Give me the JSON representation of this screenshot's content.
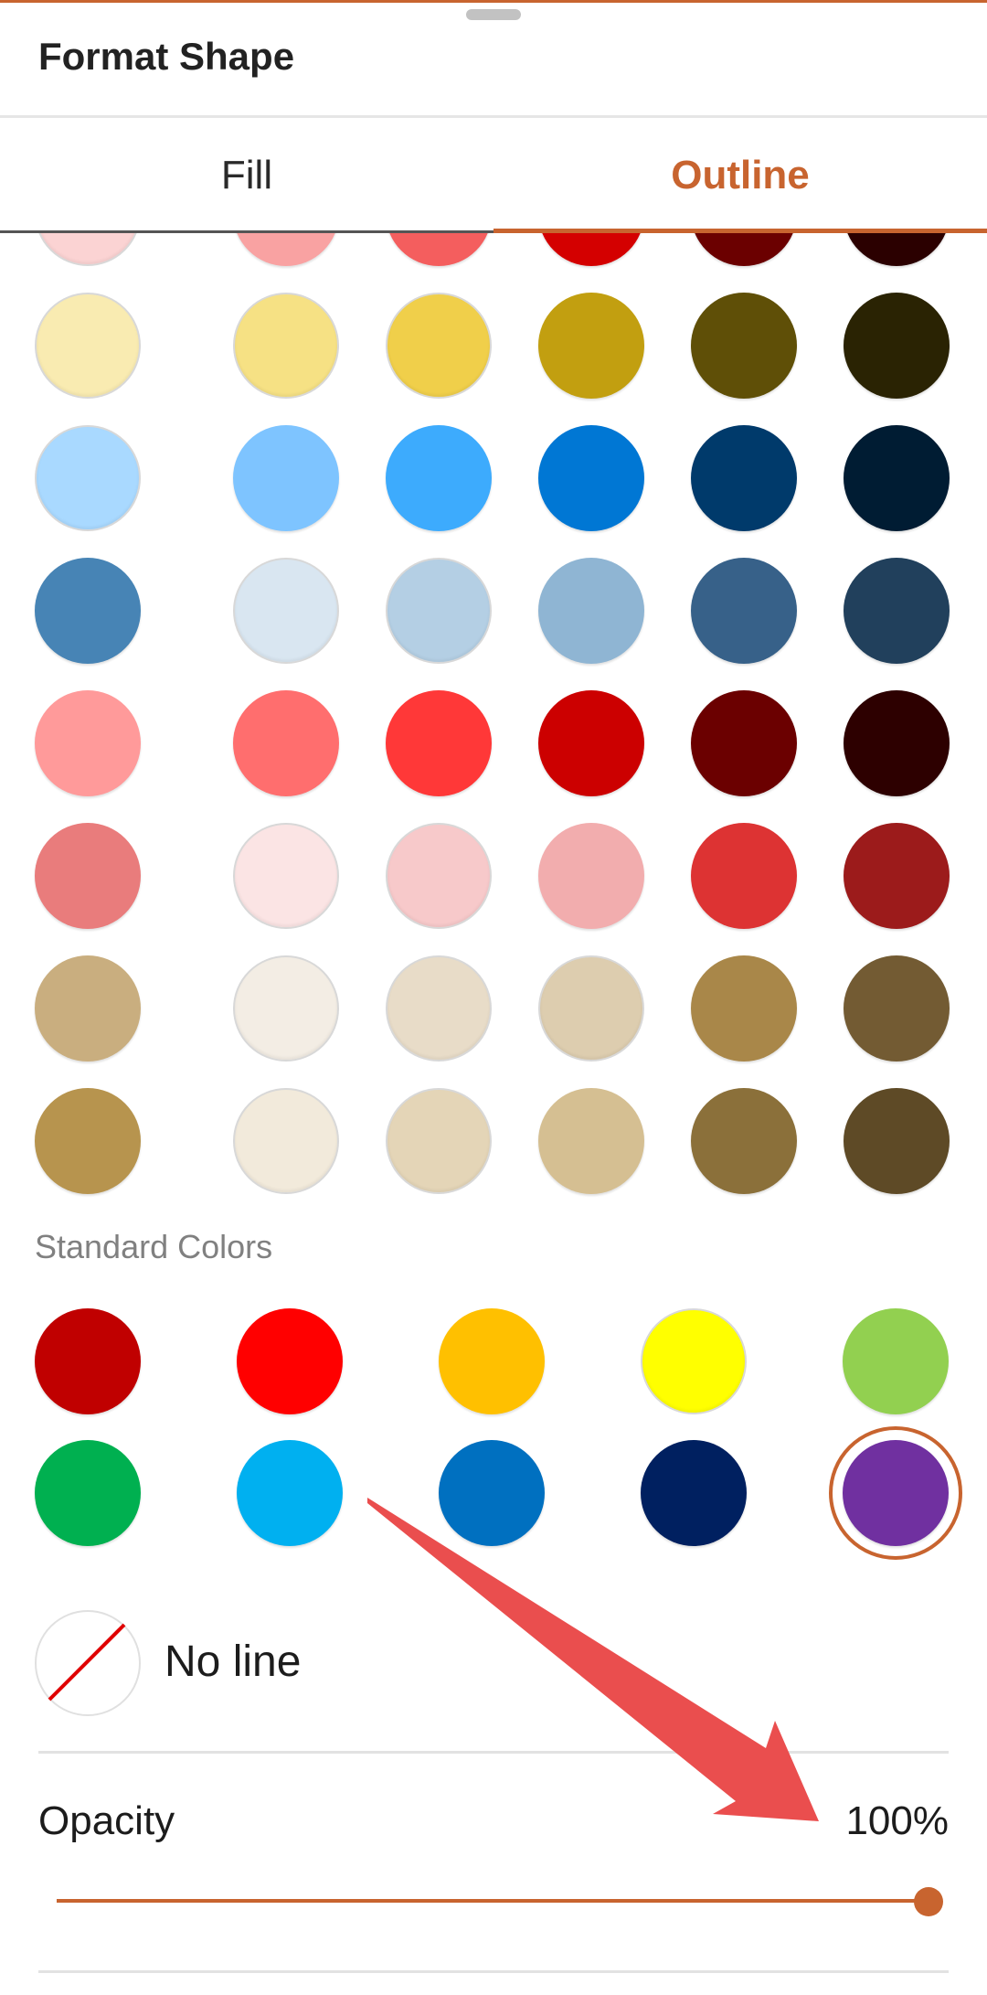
{
  "header": {
    "title": "Format Shape"
  },
  "tabs": [
    {
      "label": "Fill",
      "active": false
    },
    {
      "label": "Outline",
      "active": true
    }
  ],
  "accent_color": "#c8642f",
  "theme_colors": [
    [
      "#fbd3d3",
      "#f9a2a2",
      "#f45e5e",
      "#d40000",
      "#6b0000",
      "#2b0000"
    ],
    [
      "#f9ebb1",
      "#f6e184",
      "#f0cf4a",
      "#c29f10",
      "#5f4f07",
      "#2a2303"
    ],
    [
      "#a9d9ff",
      "#7ec4ff",
      "#3dabfd",
      "#0077d4",
      "#003a6b",
      "#001c33"
    ],
    [
      "#4784b5",
      "#d9e6f1",
      "#b4cfe4",
      "#8fb5d3",
      "#376189",
      "#21405c"
    ],
    [
      "#ff9a9a",
      "#ff6e6e",
      "#ff3838",
      "#cc0000",
      "#6b0000",
      "#2d0000"
    ],
    [
      "#e97c7c",
      "#fbe4e4",
      "#f7c9ca",
      "#f2adae",
      "#dd3333",
      "#9c1b1b"
    ],
    [
      "#c9ae7f",
      "#f3ede4",
      "#e8dcc8",
      "#ddcdaf",
      "#a98749",
      "#735b33"
    ],
    [
      "#b7944e",
      "#f2eadb",
      "#e4d5b7",
      "#d5bf92",
      "#8b703a",
      "#5e4a26"
    ]
  ],
  "standard_label": "Standard Colors",
  "standard_colors": [
    "#c00000",
    "#ff0000",
    "#ffc000",
    "#ffff00",
    "#92d050",
    "#00b050",
    "#00b0f0",
    "#0070c0",
    "#002060",
    "#7030a0"
  ],
  "selected_standard_index": 9,
  "no_line": {
    "label": "No line"
  },
  "opacity": {
    "label": "Opacity",
    "value_text": "100%",
    "value": 1.0
  }
}
